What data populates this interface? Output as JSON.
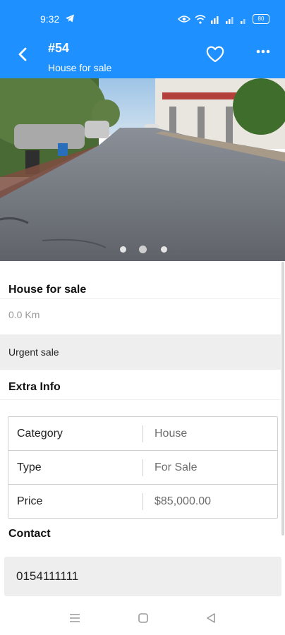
{
  "status_bar": {
    "time": "9:32",
    "battery": "80"
  },
  "header": {
    "title": "#54",
    "subtitle": "House for sale",
    "accent_color": "#1e90ff",
    "back_icon": "chevron-left-icon",
    "favorite_icon": "heart-outline-icon",
    "more_icon": "more-horizontal-icon"
  },
  "gallery": {
    "image_count": 3,
    "active_index": 1
  },
  "listing": {
    "title": "House for sale",
    "distance": "0.0 Km",
    "note": "Urgent sale"
  },
  "extra_info": {
    "heading": "Extra Info",
    "rows": [
      {
        "label": "Category",
        "value": "House"
      },
      {
        "label": "Type",
        "value": "For Sale"
      },
      {
        "label": "Price",
        "value": "$85,000.00"
      }
    ]
  },
  "contact": {
    "heading": "Contact",
    "phone": "0154111111"
  },
  "nav_bar": {
    "icons": [
      "menu-icon",
      "home-square-icon",
      "back-triangle-icon"
    ]
  }
}
